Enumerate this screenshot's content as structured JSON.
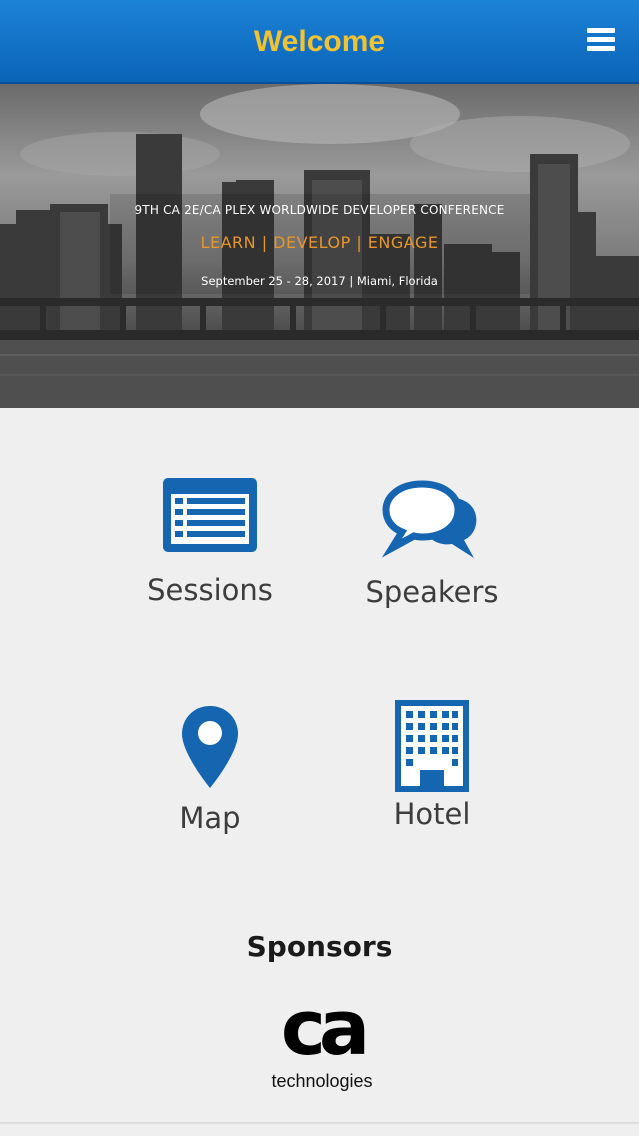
{
  "header": {
    "title": "Welcome",
    "menu_icon": "hamburger-menu-icon"
  },
  "hero": {
    "conference": "9TH CA 2E/CA PLEX WORLDWIDE DEVELOPER CONFERENCE",
    "tagline": "LEARN | DEVELOP | ENGAGE",
    "dates": "September 25 - 28, 2017 | Miami, Florida"
  },
  "tiles": [
    {
      "label": "Sessions",
      "icon": "list-icon"
    },
    {
      "label": "Speakers",
      "icon": "chat-bubbles-icon"
    },
    {
      "label": "Map",
      "icon": "map-pin-icon"
    },
    {
      "label": "Hotel",
      "icon": "building-icon"
    }
  ],
  "sponsors": {
    "title": "Sponsors",
    "logo_main": "ca",
    "logo_sub": "technologies"
  },
  "colors": {
    "header_blue": "#0a64b8",
    "title_gold": "#f1c232",
    "icon_blue": "#1565b0",
    "tagline_orange": "#e8962b"
  }
}
